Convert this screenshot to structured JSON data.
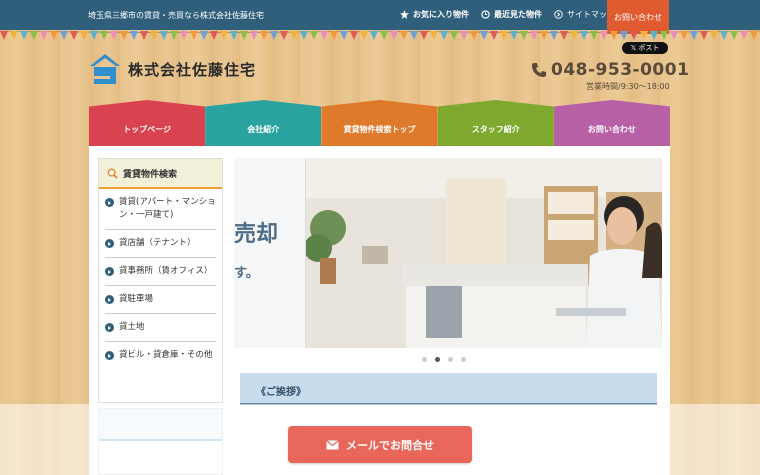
{
  "topbar": {
    "tagline": "埼玉県三郷市の賃貸・売買なら株式会社佐藤住宅",
    "favorites": "お気に入り物件",
    "recent": "最近見た物件",
    "sitemap": "サイトマップ",
    "contact": "お問い合わせ"
  },
  "header": {
    "company": "株式会社佐藤住宅",
    "post": "ポスト",
    "phone": "048-953-0001",
    "hours": "営業時間/9:30～18:00"
  },
  "nav": {
    "items": [
      {
        "label": "トップページ",
        "color": "#d9434f"
      },
      {
        "label": "会社紹介",
        "color": "#2aa3a0"
      },
      {
        "label": "賃貸物件検索トップ",
        "color": "#e07a2b"
      },
      {
        "label": "スタッフ紹介",
        "color": "#7fa82f"
      },
      {
        "label": "お問い合わせ",
        "color": "#b860a6"
      }
    ]
  },
  "sidebar": {
    "title": "賃貸物件検索",
    "items": [
      {
        "label": "賃貸(アパート・マンション・一戸建て)"
      },
      {
        "label": "貸店舗（テナント）"
      },
      {
        "label": "貸事務所（賃オフィス）"
      },
      {
        "label": "貸駐車場"
      },
      {
        "label": "貸土地"
      },
      {
        "label": "貸ビル・貸倉庫・その他"
      }
    ]
  },
  "slider": {
    "text_big": "売却",
    "text_small": "す。",
    "dots": 4,
    "active_dot": 2
  },
  "greeting": {
    "title": "《ご挨拶》"
  },
  "cta": {
    "mail_label": "メールでお問合せ"
  },
  "colors": {
    "topbar": "#2f5f7a",
    "contact_tab": "#e05b2f",
    "cta": "#e8675a"
  }
}
